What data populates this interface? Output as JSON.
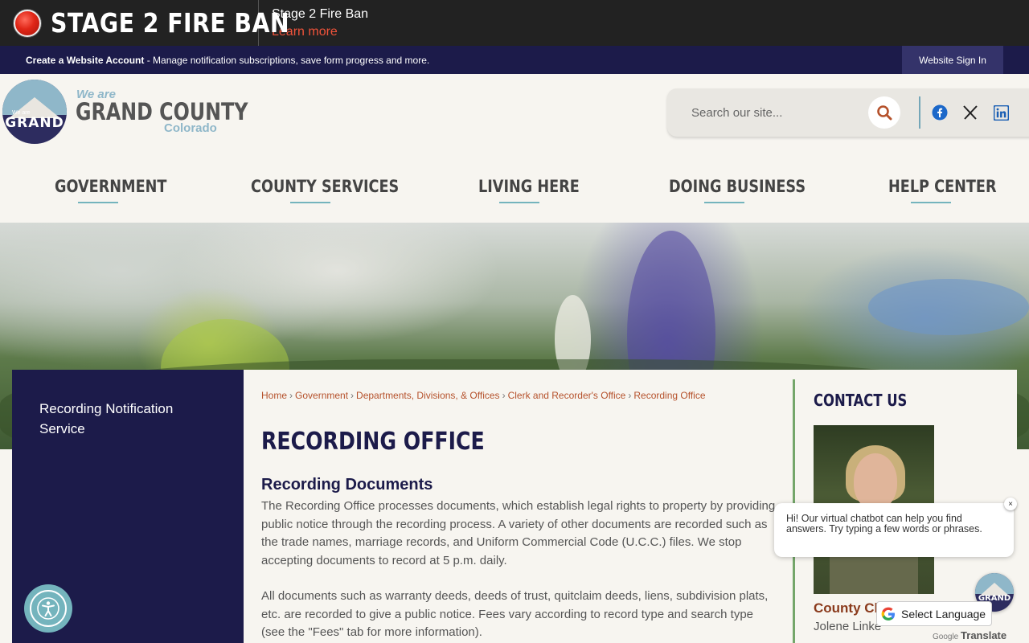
{
  "alert": {
    "title": "STAGE 2 FIRE BAN",
    "heading": "Stage 2 Fire Ban",
    "link": "Learn more"
  },
  "account_bar": {
    "create_label": "Create a Website Account",
    "message": " - Manage notification subscriptions, save form progress and more.",
    "signin_label": "Website Sign In"
  },
  "brand": {
    "we_are": "We are",
    "name": "GRAND COUNTY",
    "state": "Colorado",
    "logo_top": "We are",
    "logo_word": "GRAND"
  },
  "search": {
    "placeholder": "Search our site..."
  },
  "social": [
    "facebook-icon",
    "x-icon",
    "linkedin-icon"
  ],
  "nav": {
    "items": [
      {
        "label": "GOVERNMENT"
      },
      {
        "label": "COUNTY SERVICES"
      },
      {
        "label": "LIVING HERE"
      },
      {
        "label": "DOING BUSINESS"
      },
      {
        "label": "HELP CENTER"
      }
    ]
  },
  "sidebar": {
    "items": [
      {
        "label": "Recording Notification Service"
      }
    ]
  },
  "breadcrumb": {
    "items": [
      "Home",
      "Government",
      "Departments, Divisions, & Offices",
      "Clerk and Recorder's Office",
      "Recording Office"
    ],
    "separator": "›"
  },
  "main": {
    "title": "RECORDING OFFICE",
    "section_title": "Recording Documents",
    "paragraph1": "The Recording Office processes documents, which establish legal rights to property by providing public notice through the recording process. A variety of other documents are recorded such as the trade names, marriage records, and Uniform Commercial Code (U.C.C.) files. We stop accepting documents to record at 5 p.m. daily.",
    "paragraph2": "All documents such as warranty deeds, deeds of trust, quitclaim deeds, liens, subdivision plats, etc. are recorded to give a public notice.  Fees vary according to record type and search type (see the \"Fees\" tab for more information)."
  },
  "contact": {
    "title": "CONTACT US",
    "role": "County Cl",
    "name": "Jolene Linke"
  },
  "chatbot": {
    "message": "Hi! Our virtual chatbot can help you find answers. Try typing a few words or phrases.",
    "close": "×",
    "logo_word": "GRAND"
  },
  "translate": {
    "label": "Select Language",
    "powered_prefix": "Google",
    "powered_word": "Translate"
  },
  "colors": {
    "navy": "#1c1b4a",
    "teal": "#74b4bd",
    "rust": "#b5512b",
    "alert_red": "#e02617"
  }
}
